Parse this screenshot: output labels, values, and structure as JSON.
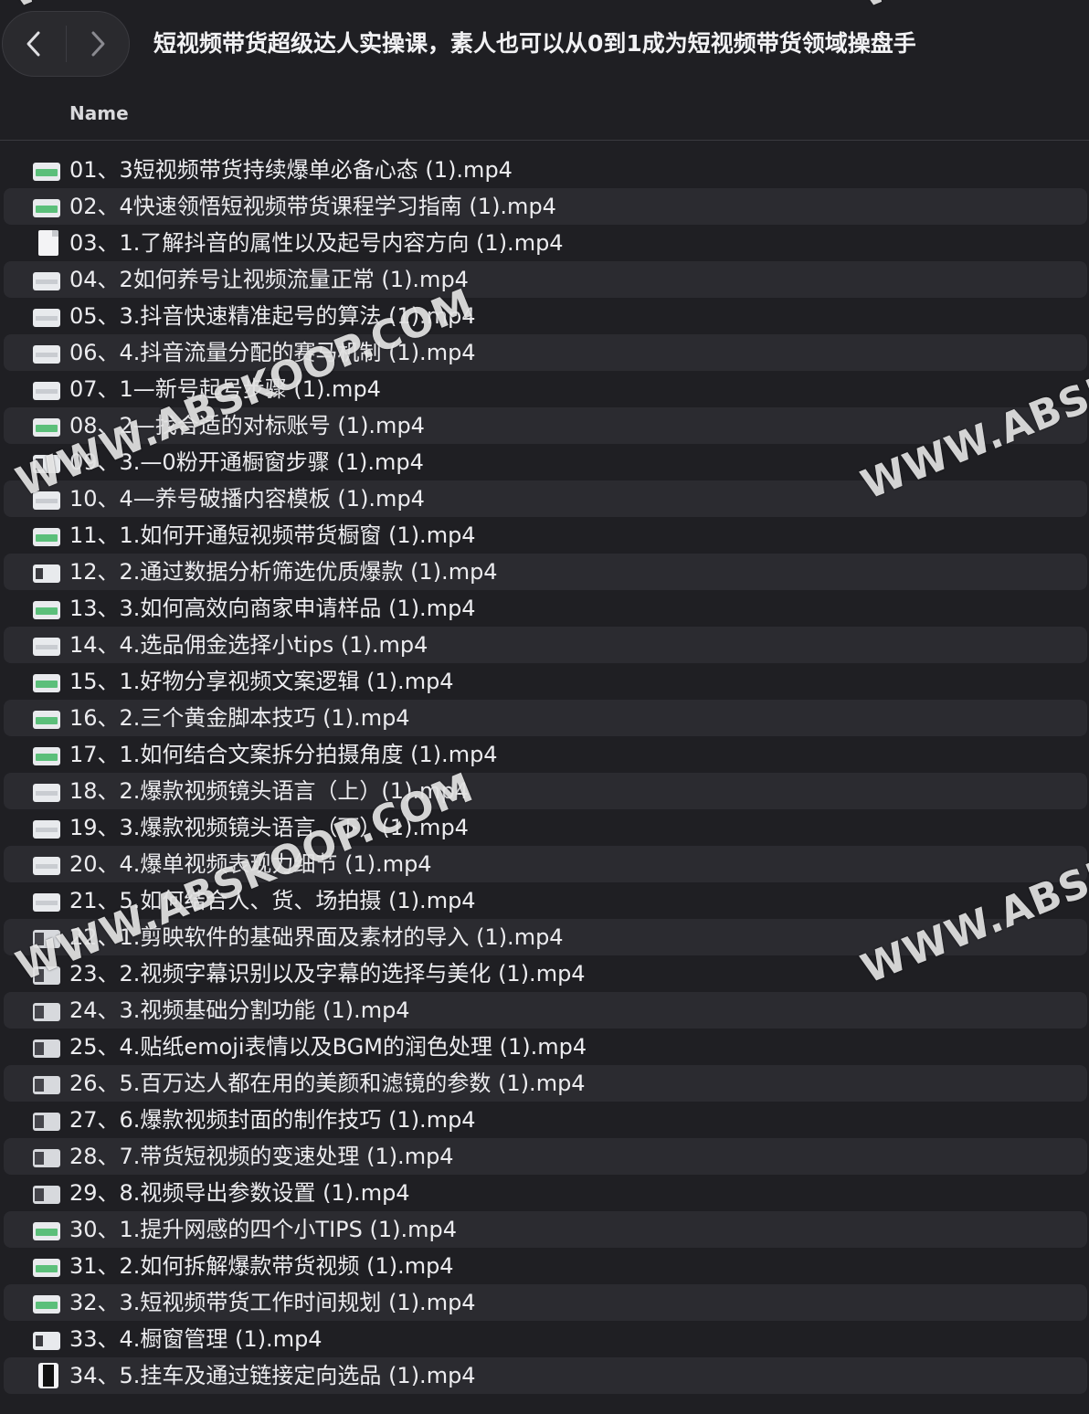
{
  "toolbar": {
    "title": "短视频带货超级达人实操课，素人也可以从0到1成为短视频带货领域操盘手",
    "back_icon": "chevron-left-icon",
    "forward_icon": "chevron-right-icon"
  },
  "columns": {
    "name": "Name"
  },
  "files": [
    {
      "name": "01、3短视频带货持续爆单必备心态 (1).mp4",
      "icon": "green"
    },
    {
      "name": "02、4快速领悟短视频带货课程学习指南 (1).mp4",
      "icon": "green"
    },
    {
      "name": "03、1.了解抖音的属性以及起号内容方向 (1).mp4",
      "icon": "doc"
    },
    {
      "name": "04、2如何养号让视频流量正常 (1).mp4",
      "icon": "pale"
    },
    {
      "name": "05、3.抖音快速精准起号的算法 (1).mp4",
      "icon": "pale"
    },
    {
      "name": "06、4.抖音流量分配的赛马机制 (1).mp4",
      "icon": "pale"
    },
    {
      "name": "07、1—新号起号步骤 (1).mp4",
      "icon": "pale"
    },
    {
      "name": "08、2—找合适的对标账号 (1).mp4",
      "icon": "green"
    },
    {
      "name": "09、3.—0粉开通橱窗步骤 (1).mp4",
      "icon": "dark"
    },
    {
      "name": "10、4—养号破播内容模板 (1).mp4",
      "icon": "pale"
    },
    {
      "name": "11、1.如何开通短视频带货橱窗 (1).mp4",
      "icon": "green"
    },
    {
      "name": "12、2.通过数据分析筛选优质爆款 (1).mp4",
      "icon": "dark"
    },
    {
      "name": "13、3.如何高效向商家申请样品 (1).mp4",
      "icon": "green"
    },
    {
      "name": "14、4.选品佣金选择小tips (1).mp4",
      "icon": "pale"
    },
    {
      "name": "15、1.好物分享视频文案逻辑 (1).mp4",
      "icon": "green"
    },
    {
      "name": "16、2.三个黄金脚本技巧 (1).mp4",
      "icon": "green"
    },
    {
      "name": "17、1.如何结合文案拆分拍摄角度 (1).mp4",
      "icon": "green"
    },
    {
      "name": "18、2.爆款视频镜头语言（上）(1).mp4",
      "icon": "pale"
    },
    {
      "name": "19、3.爆款视频镜头语言（下）(1).mp4",
      "icon": "pale"
    },
    {
      "name": "20、4.爆单视频表现力细节 (1).mp4",
      "icon": "pale"
    },
    {
      "name": "21、5.如何结合人、货、场拍摄 (1).mp4",
      "icon": "pale"
    },
    {
      "name": "22、1.剪映软件的基础界面及素材的导入 (1).mp4",
      "icon": "film"
    },
    {
      "name": "23、2.视频字幕识别以及字幕的选择与美化 (1).mp4",
      "icon": "film"
    },
    {
      "name": "24、3.视频基础分割功能 (1).mp4",
      "icon": "film"
    },
    {
      "name": "25、4.贴纸emoji表情以及BGM的润色处理 (1).mp4",
      "icon": "film"
    },
    {
      "name": "26、5.百万达人都在用的美颜和滤镜的参数 (1).mp4",
      "icon": "film"
    },
    {
      "name": "27、6.爆款视频封面的制作技巧 (1).mp4",
      "icon": "film"
    },
    {
      "name": "28、7.带货短视频的变速处理 (1).mp4",
      "icon": "film"
    },
    {
      "name": "29、8.视频导出参数设置 (1).mp4",
      "icon": "film"
    },
    {
      "name": "30、1.提升网感的四个小TIPS (1).mp4",
      "icon": "green"
    },
    {
      "name": "31、2.如何拆解爆款带货视频 (1).mp4",
      "icon": "green"
    },
    {
      "name": "32、3.短视频带货工作时间规划 (1).mp4",
      "icon": "green"
    },
    {
      "name": "33、4.橱窗管理 (1).mp4",
      "icon": "dark"
    },
    {
      "name": "34、5.挂车及通过链接定向选品 (1).mp4",
      "icon": "black"
    }
  ],
  "watermarks": [
    "WWW.ABSKOOP.COM",
    "WWW.ABSKOOP.COM",
    "WWW.ABSKO",
    "WWW.ABSKO",
    "WWW",
    "WWW"
  ]
}
